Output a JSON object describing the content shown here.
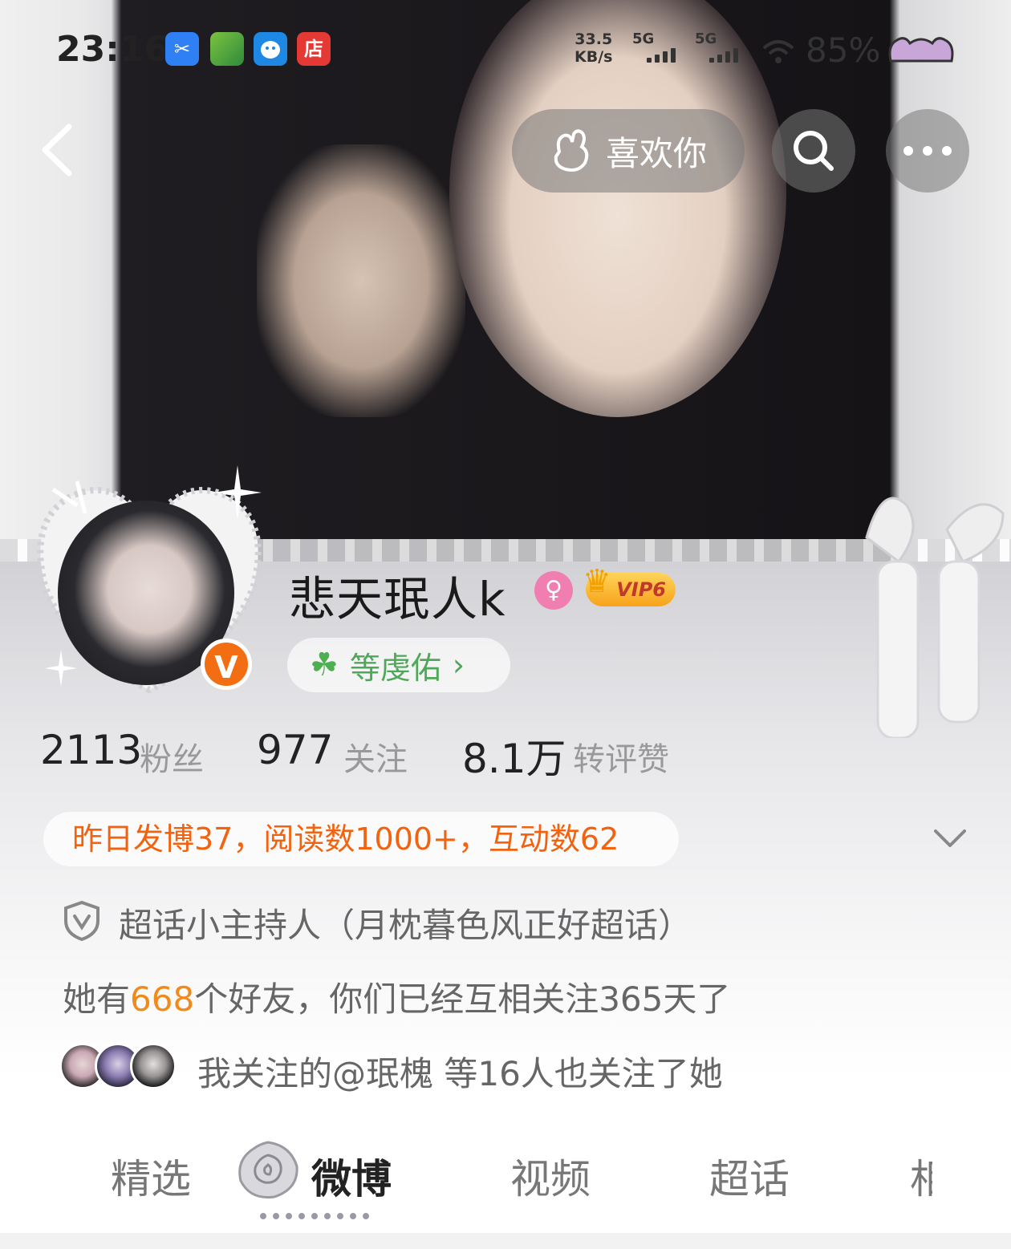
{
  "status_bar": {
    "time": "23:16",
    "apps": [
      {
        "icon": "screenshot-icon",
        "glyph": "✂",
        "color": "#2f7ff5"
      },
      {
        "icon": "game-icon",
        "glyph": "",
        "color": "#4caf50"
      },
      {
        "icon": "qq-icon",
        "glyph": "",
        "color": "#1e88e5"
      },
      {
        "icon": "store-icon",
        "glyph": "店",
        "color": "#e53935"
      }
    ],
    "net_speed_value": "33.5",
    "net_speed_unit": "KB/s",
    "sim1": "5G",
    "sim2": "5G",
    "battery": "85%"
  },
  "nav": {
    "like_label": "喜欢你"
  },
  "profile": {
    "username": "悲天珉人k",
    "gender_icon": "female-icon",
    "vip_label": "VIP6",
    "tag_label": "等虔佑",
    "tag_arrow": "›",
    "verified": "V"
  },
  "stats": [
    {
      "value": "2113",
      "label": "粉丝"
    },
    {
      "value": "977",
      "label": "关注"
    },
    {
      "value": "8.1万",
      "label": "转评赞"
    }
  ],
  "activity_text": "昨日发博37，阅读数1000+，互动数62",
  "host_text": "超话小主持人（月枕暮色风正好超话）",
  "friends": {
    "prefix": "她有",
    "count": "668",
    "suffix": "个好友，你们已经互相关注365天了"
  },
  "mutual_text": "我关注的@珉槐 等16人也关注了她",
  "tabs": [
    "精选",
    "微博",
    "视频",
    "超话",
    "相"
  ],
  "colors": {
    "accent_orange": "#f2620f",
    "friend_highlight": "#f08a1c",
    "tag_green": "#4fa85a",
    "vip_gold": "#f7a21b",
    "gender_pink": "#f07eb0"
  }
}
